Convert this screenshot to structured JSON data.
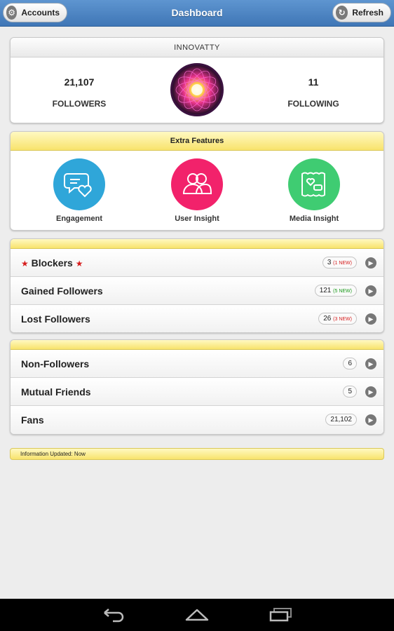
{
  "topbar": {
    "title": "Dashboard",
    "accounts_label": "Accounts",
    "refresh_label": "Refresh",
    "accounts_icon": "gear-icon",
    "refresh_icon": "refresh-icon"
  },
  "profile": {
    "username": "INNOVATTY",
    "followers_count": "21,107",
    "followers_label": "FOLLOWERS",
    "following_count": "11",
    "following_label": "FOLLOWING"
  },
  "features": {
    "header": "Extra Features",
    "items": [
      {
        "label": "Engagement",
        "icon": "engagement-icon",
        "color": "#2fa6d9"
      },
      {
        "label": "User Insight",
        "icon": "user-insight-icon",
        "color": "#f2226b"
      },
      {
        "label": "Media Insight",
        "icon": "media-insight-icon",
        "color": "#3fcc72"
      }
    ]
  },
  "list1": [
    {
      "label": "Blockers",
      "count": "3",
      "new": "(1 NEW)",
      "new_color": "red",
      "starred": true
    },
    {
      "label": "Gained Followers",
      "count": "121",
      "new": "(5 NEW)",
      "new_color": "green"
    },
    {
      "label": "Lost Followers",
      "count": "26",
      "new": "(3 NEW)",
      "new_color": "red"
    }
  ],
  "list2": [
    {
      "label": "Non-Followers",
      "count": "6"
    },
    {
      "label": "Mutual Friends",
      "count": "5"
    },
    {
      "label": "Fans",
      "count": "21,102"
    }
  ],
  "status": {
    "info": "Information Updated: Now"
  },
  "colors": {
    "topbar": "#4a83c4",
    "yellow": "#f8e36c",
    "star": "#d61d1d"
  }
}
